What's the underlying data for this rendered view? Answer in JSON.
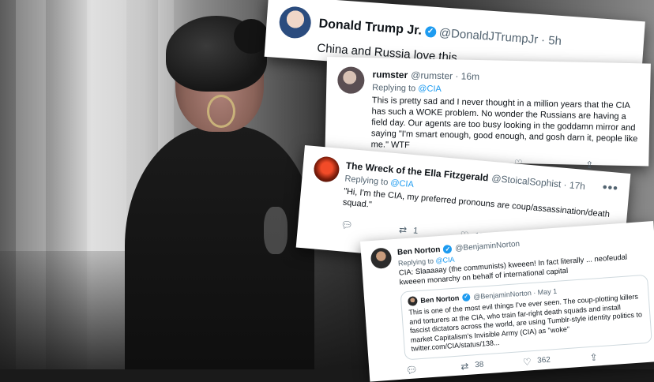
{
  "tweets": [
    {
      "name": "Donald Trump Jr.",
      "handle": "@DonaldJTrumpJr",
      "time": "· 5h",
      "text": "China and Russia love this.",
      "more": "•••"
    },
    {
      "name": "rumster",
      "handle": "@rumster · 16m",
      "replying_prefix": "Replying to",
      "replying_to": "@CIA",
      "text": "This is pretty sad and I never thought in a million years that the CIA has such a WOKE problem. No wonder the Russians are having a field day. Our agents are too busy looking in the goddamn mirror and saying \"I'm smart enough, good enough, and gosh darn it, people like me.\" WTF",
      "actions": {
        "reply": "",
        "retweet": "",
        "like": ""
      }
    },
    {
      "name": "The Wreck of the Ella Fitzgerald",
      "handle": "@StoicalSophist · 17h",
      "replying_prefix": "Replying to",
      "replying_to": "@CIA",
      "text": "\"Hi, I'm the CIA, my preferred pronouns are coup/assassination/death squad.\"",
      "more": "•••",
      "actions": {
        "reply": "",
        "retweet": "1",
        "like": "15"
      }
    },
    {
      "name": "Ben Norton",
      "handle": "@BenjaminNorton",
      "replying_prefix": "Replying to",
      "replying_to": "@CIA",
      "text": "CIA: Slaaaaay (the communists) kweeen! In fact literally ... neofeudal kweeen monarchy on behalf of international capital",
      "quote": {
        "name": "Ben Norton",
        "handle": "@BenjaminNorton · May 1",
        "text": "This is one of the most evil things I've ever seen. The coup-plotting killers and torturers at the CIA, who train far-right death squads and install fascist dictators across the world, are using Tumblr-style identity politics to market Capitalism's Invisible Army (CIA) as \"woke\" twitter.com/CIA/status/138..."
      },
      "actions": {
        "reply": "",
        "retweet": "38",
        "like": "362"
      }
    }
  ],
  "icons": {
    "verified": "verified-badge-icon",
    "reply": "reply-icon",
    "retweet": "retweet-icon",
    "like": "heart-icon",
    "share": "share-icon"
  }
}
